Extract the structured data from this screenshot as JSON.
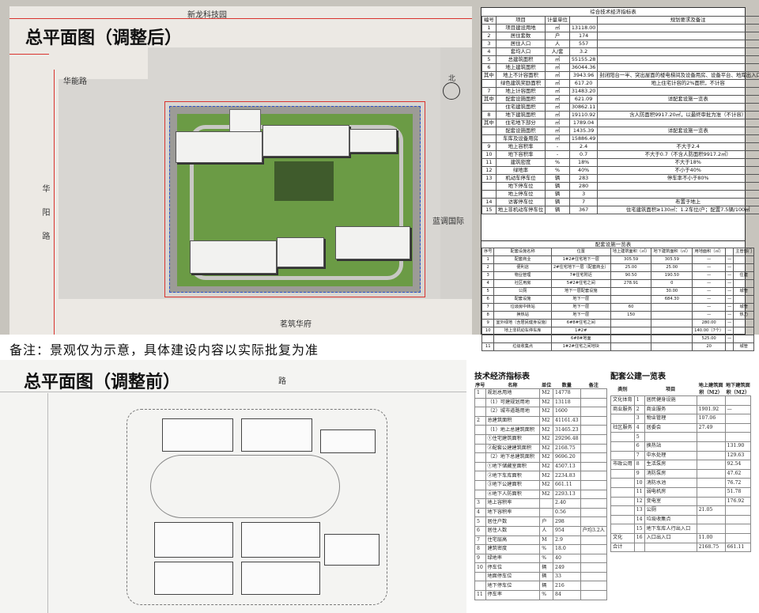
{
  "top_title": "总平面图（调整后）",
  "bottom_title": "总平面图（调整前）",
  "note": "备注：景观仅为示意，具体建设内容以实际批复为准",
  "plan_after": {
    "roads": [
      "新龙科技园",
      "华能路",
      "华阳路",
      "蓝调国际",
      "茗筑华府"
    ],
    "north": "北"
  },
  "plan_before": {
    "road": "路"
  },
  "tech_table": {
    "title": "综合技术经济指标表",
    "headers": [
      "编号",
      "项目",
      "计量单位",
      "",
      "规划要求及备注"
    ],
    "rows": [
      [
        "1",
        "项目建设用地",
        "㎡",
        "13118.00",
        ""
      ],
      [
        "2",
        "居住套数",
        "户",
        "174",
        ""
      ],
      [
        "3",
        "居住人口",
        "人",
        "557",
        ""
      ],
      [
        "4",
        "套均人口",
        "人/套",
        "3.2",
        ""
      ],
      [
        "5",
        "总建筑面积",
        "㎡",
        "55155.28",
        ""
      ],
      [
        "6",
        "地上建筑面积",
        "㎡",
        "36044.36",
        ""
      ],
      [
        "其中",
        "地上不计容面积",
        "㎡",
        "3943.96",
        "封闭阳台一半、突出屋面的楼电梯间及设备用房、设备平台、地库出入口顶盖等"
      ],
      [
        "",
        "绿色建筑奖励面积",
        "㎡",
        "617.20",
        "地上住宅计容的2%面积，不计容"
      ],
      [
        "7",
        "地上计容面积",
        "㎡",
        "31483.20",
        ""
      ],
      [
        "其中",
        "配套设施面积",
        "㎡",
        "621.09",
        "详配套设施一览表"
      ],
      [
        "",
        "住宅建筑面积",
        "㎡",
        "30862.11",
        ""
      ],
      [
        "8",
        "地下建筑面积",
        "㎡",
        "19110.92",
        "含人防面积9917.20㎡，以最终审批为准（不计容）"
      ],
      [
        "其中",
        "住宅地下部分",
        "㎡",
        "1789.04",
        ""
      ],
      [
        "",
        "配套设施面积",
        "㎡",
        "1435.39",
        "详配套设施一览表"
      ],
      [
        "",
        "车库及设备用房",
        "㎡",
        "15886.49",
        ""
      ],
      [
        "9",
        "地上容积率",
        "-",
        "2.4",
        "不大于2.4"
      ],
      [
        "10",
        "地下容积率",
        "-",
        "0.7",
        "不大于0.7（不含人防面积9917.2㎡）"
      ],
      [
        "11",
        "建筑密度",
        "%",
        "18%",
        "不大于18%"
      ],
      [
        "12",
        "绿地率",
        "%",
        "40%",
        "不小于40%"
      ],
      [
        "13",
        "机动车停车位",
        "辆",
        "283",
        "停车率不小于80%"
      ],
      [
        "",
        "地下停车位",
        "辆",
        "280",
        ""
      ],
      [
        "",
        "地上停车位",
        "辆",
        "3",
        ""
      ],
      [
        "14",
        "访客停车位",
        "辆",
        "7",
        "布置于地上"
      ],
      [
        "15",
        "地上非机动车停车位",
        "辆",
        "367",
        "住宅建筑面积≥130㎡：1.2车位/户；配置7.5辆/100㎡"
      ]
    ]
  },
  "facility_table": {
    "title": "配套设施一览表",
    "headers": [
      "序号",
      "配套设施名称",
      "位置",
      "地上建筑面积（㎡）",
      "地下建筑面积（㎡）",
      "用地面积（㎡）",
      "",
      "主管部门"
    ],
    "rows": [
      [
        "1",
        "配套商业",
        "1#2#住宅地下一层",
        "305.59",
        "305.59",
        "—",
        "—",
        ""
      ],
      [
        "2",
        "便利店",
        "2#住宅地下一层（配套商业）",
        "25.00",
        "25.00",
        "—",
        "—",
        ""
      ],
      [
        "3",
        "物业管理",
        "7#住宅附近",
        "90.50",
        "190.50",
        "—",
        "—",
        "住建"
      ],
      [
        "4",
        "社区用房",
        "5#2#住宅之间",
        "278.91",
        "0",
        "—",
        "—",
        ""
      ],
      [
        "5",
        "公厕",
        "地下一层配套设施",
        "",
        "30.00",
        "—",
        "—",
        "城管"
      ],
      [
        "6",
        "配套设施",
        "地下一层",
        "",
        "684.30",
        "—",
        "—",
        ""
      ],
      [
        "7",
        "垃圾房中转站",
        "地下一层",
        "60",
        "",
        "—",
        "—",
        "城管"
      ],
      [
        "8",
        "换热站",
        "地下一层",
        "150",
        "",
        "—",
        "—",
        "热力"
      ],
      [
        "9",
        "室外绿地（含居民健身设施）",
        "6#8#住宅之间",
        "",
        "",
        "280.00",
        "—",
        ""
      ],
      [
        "10",
        "地上非机动车停车库",
        "1#2#",
        "",
        "",
        "140.00（7个）",
        "—",
        ""
      ],
      [
        "",
        "",
        "6#8#地面",
        "",
        "",
        "525.00",
        "—",
        ""
      ],
      [
        "11",
        "垃圾收集点",
        "1#2#住宅之间地块",
        "",
        "",
        "20",
        "",
        "城管"
      ]
    ]
  },
  "old_tech_table": {
    "title": "技术经济指标表",
    "headers": [
      "序号",
      "名称",
      "单位",
      "数量",
      "备注"
    ],
    "rows": [
      [
        "1",
        "规划总用地",
        "M2",
        "14778",
        ""
      ],
      [
        "",
        "（1）可建规划用地",
        "M2",
        "13118",
        ""
      ],
      [
        "",
        "（2）城市道路用地",
        "M2",
        "1600",
        ""
      ],
      [
        "2",
        "总建筑面积",
        "M2",
        "41161.43",
        ""
      ],
      [
        "",
        "（1）地上总建筑面积",
        "M2",
        "31465.23",
        ""
      ],
      [
        "",
        "①住宅建筑面积",
        "M2",
        "29296.48",
        ""
      ],
      [
        "",
        "②配套公建建筑面积",
        "M2",
        "2168.75",
        ""
      ],
      [
        "",
        "（2）地下总建筑面积",
        "M2",
        "9696.20",
        ""
      ],
      [
        "",
        "①地下储藏室面积",
        "M2",
        "4507.13",
        ""
      ],
      [
        "",
        "②地下车库面积",
        "M2",
        "2234.83",
        ""
      ],
      [
        "",
        "③地下公建面积",
        "M2",
        "661.11",
        ""
      ],
      [
        "",
        "④地下人防面积",
        "M2",
        "2293.13",
        ""
      ],
      [
        "3",
        "地上容积率",
        "",
        "2.40",
        ""
      ],
      [
        "4",
        "地下容积率",
        "",
        "0.56",
        ""
      ],
      [
        "5",
        "居住户数",
        "户",
        "298",
        ""
      ],
      [
        "6",
        "居住人数",
        "人",
        "954",
        "户均3.2人"
      ],
      [
        "7",
        "住宅层高",
        "M",
        "2.9",
        ""
      ],
      [
        "8",
        "建筑密度",
        "%",
        "18.0",
        ""
      ],
      [
        "9",
        "绿地率",
        "%",
        "40",
        ""
      ],
      [
        "10",
        "停车位",
        "辆",
        "249",
        ""
      ],
      [
        "",
        "地面停车位",
        "辆",
        "33",
        ""
      ],
      [
        "",
        "地下停车位",
        "辆",
        "216",
        ""
      ],
      [
        "11",
        "停车率",
        "%",
        "84",
        ""
      ]
    ]
  },
  "old_facility_table": {
    "title": "配套公建一览表",
    "headers": [
      "类别",
      "",
      "项目",
      "地上建筑面积（M2）",
      "地下建筑面积（M2）"
    ],
    "rows": [
      [
        "文化体育",
        "1",
        "居民健身设施",
        "",
        ""
      ],
      [
        "商业服务",
        "2",
        "商业服务",
        "1901.92",
        "—"
      ],
      [
        "",
        "3",
        "物业管理",
        "107.06",
        ""
      ],
      [
        "社区服务",
        "4",
        "居委会",
        "27.49",
        ""
      ],
      [
        "",
        "5",
        "",
        "",
        ""
      ],
      [
        "",
        "6",
        "换热站",
        "",
        "131.90"
      ],
      [
        "",
        "7",
        "中水处理",
        "",
        "129.63"
      ],
      [
        "市政公用",
        "8",
        "生活泵房",
        "",
        "92.54"
      ],
      [
        "",
        "9",
        "消防泵房",
        "",
        "47.62"
      ],
      [
        "",
        "10",
        "消防水池",
        "",
        "76.72"
      ],
      [
        "",
        "11",
        "弱电机房",
        "",
        "51.78"
      ],
      [
        "",
        "12",
        "变电室",
        "",
        "176.92"
      ],
      [
        "",
        "13",
        "公厕",
        "21.05",
        ""
      ],
      [
        "",
        "14",
        "垃圾收集点",
        "",
        ""
      ],
      [
        "",
        "15",
        "地下车库人行出入口",
        "",
        ""
      ],
      [
        "文化",
        "16",
        "入口出入口",
        "11.00",
        ""
      ],
      [
        "合计",
        "",
        "",
        "2168.75",
        "661.11"
      ]
    ]
  }
}
